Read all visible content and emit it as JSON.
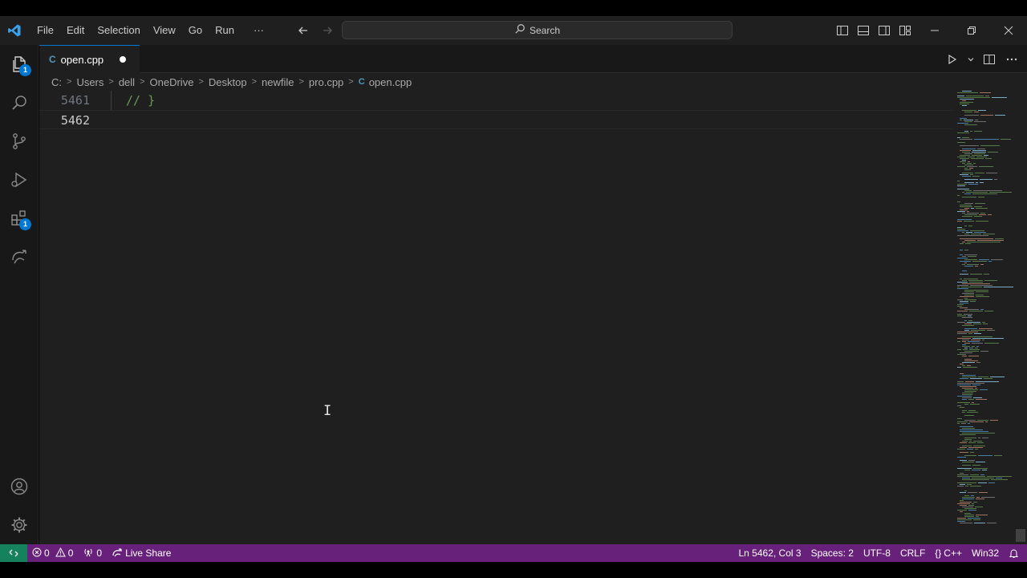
{
  "titlebar": {
    "menu": [
      "File",
      "Edit",
      "Selection",
      "View",
      "Go",
      "Run",
      "···"
    ],
    "search_placeholder": "Search"
  },
  "activity": {
    "explorer_badge": "1",
    "extensions_badge": "1"
  },
  "tab": {
    "label": "open.cpp",
    "icon_glyph": "C"
  },
  "breadcrumb": [
    "C:",
    "Users",
    "dell",
    "OneDrive",
    "Desktop",
    "newfile",
    "pro.cpp",
    "open.cpp"
  ],
  "code": [
    {
      "number": "5461",
      "text": "// }"
    },
    {
      "number": "5462",
      "text": ""
    }
  ],
  "status": {
    "errors": "0",
    "warnings": "0",
    "ports": "0",
    "live_share": "Live Share",
    "position": "Ln 5462, Col 3",
    "spaces": "Spaces: 2",
    "encoding": "UTF-8",
    "eol": "CRLF",
    "language": "C++",
    "platform": "Win32"
  },
  "colors": {
    "statusbar": "#68217a",
    "remote": "#16825d",
    "accent": "#0078d4",
    "comment": "#6a9955"
  }
}
